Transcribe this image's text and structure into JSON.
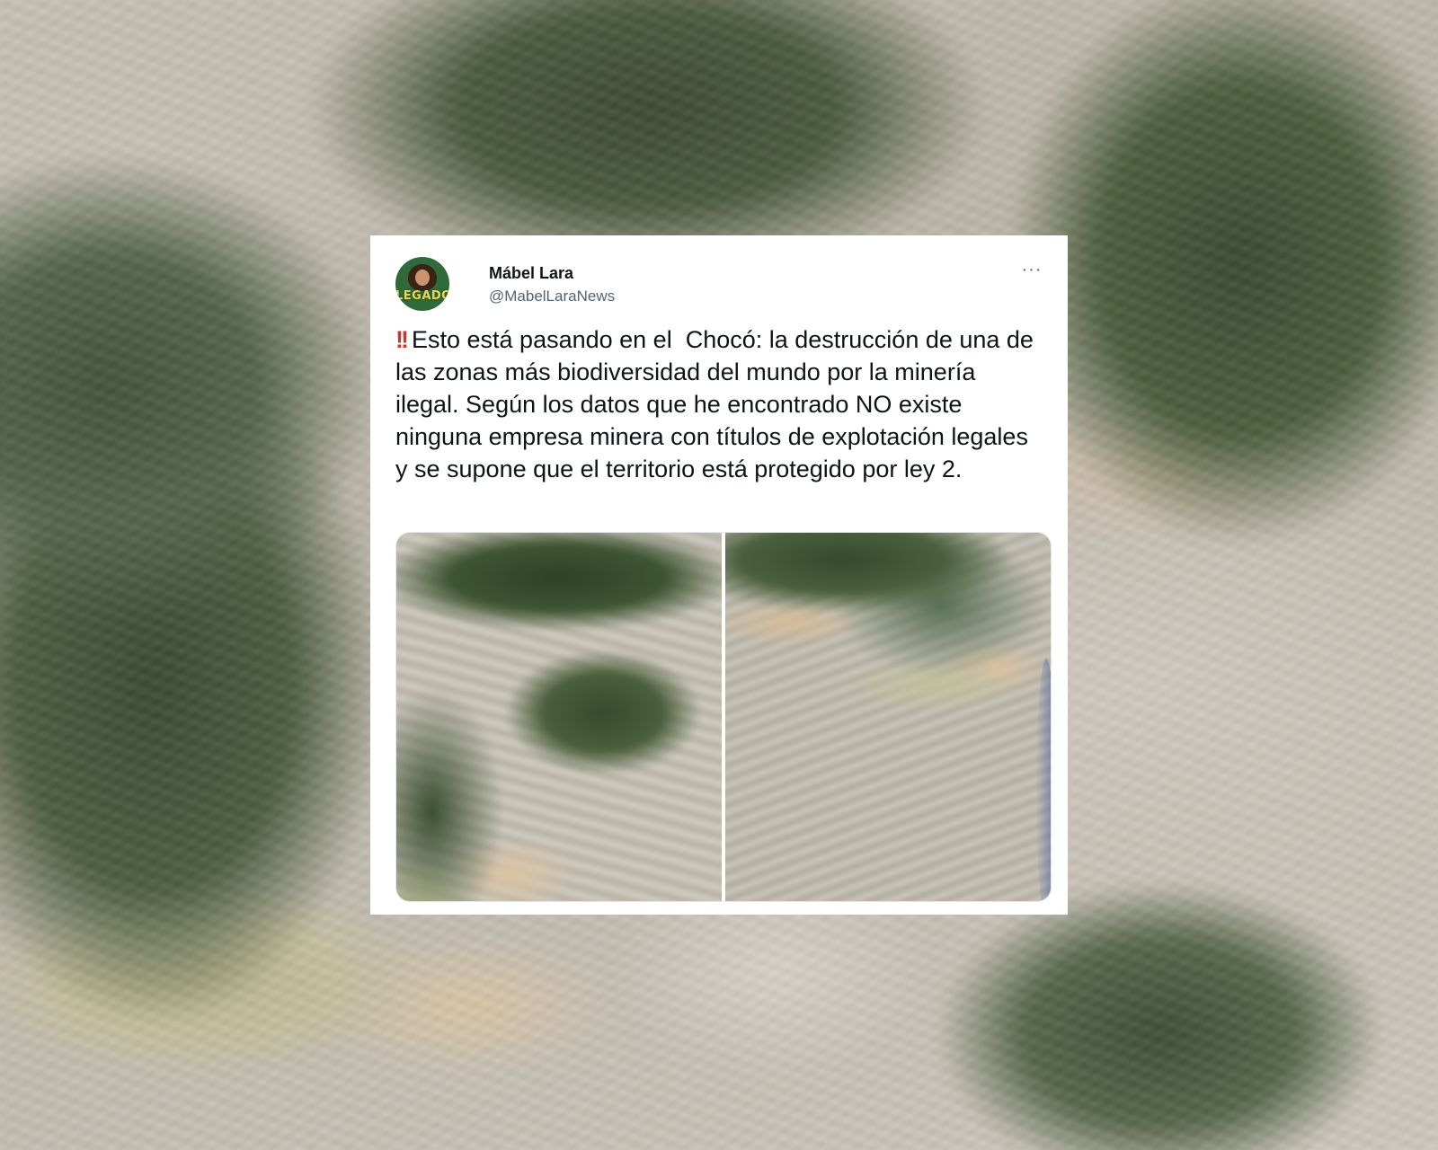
{
  "tweet": {
    "display_name": "Mábel Lara",
    "handle": "@MabelLaraNews",
    "avatar_label": "LEGADO",
    "more_icon": "more-horizontal-icon",
    "more_label": "···",
    "emphasis_glyph": "!!",
    "text": "Esto está pasando en el  Chocó: la destrucción de una de las zonas más biodiversidad del mundo por la minería ilegal. Según los datos que he encontrado NO existe ninguna empresa minera con títulos de explotación legales  y se supone que el territorio está protegido por ley 2.",
    "media_count": 2,
    "colors": {
      "text": "#0f1419",
      "secondary": "#536471",
      "emphasis": "#d4322c",
      "card_bg": "#ffffff"
    }
  }
}
